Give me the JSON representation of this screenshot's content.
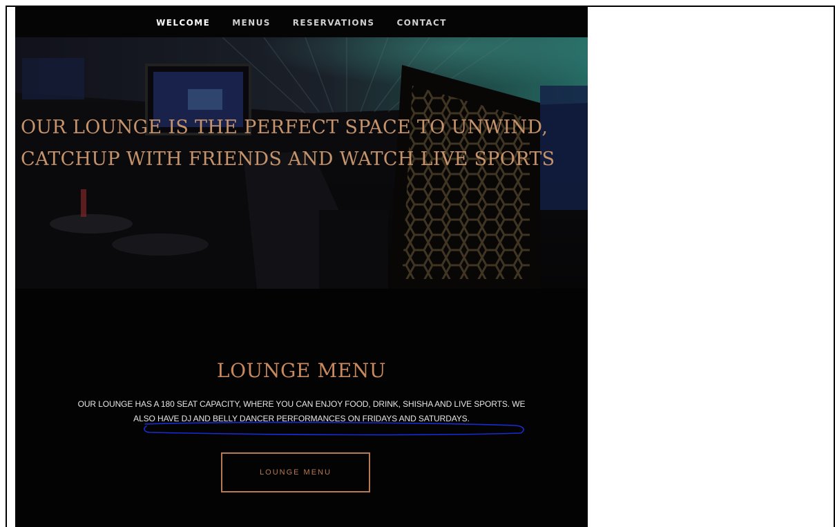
{
  "nav": {
    "items": [
      {
        "label": "WELCOME",
        "active": true
      },
      {
        "label": "MENUS",
        "active": false
      },
      {
        "label": "RESERVATIONS",
        "active": false
      },
      {
        "label": "CONTACT",
        "active": false
      }
    ]
  },
  "hero": {
    "headline": "OUR LOUNGE IS THE PERFECT SPACE TO UNWIND,\nCATCHUP WITH FRIENDS AND WATCH LIVE SPORTS"
  },
  "lounge": {
    "title": "LOUNGE MENU",
    "description_line1": "OUR LOUNGE HAS A 180 SEAT CAPACITY, WHERE YOU CAN ENJOY FOOD, DRINK, SHISHA AND LIVE SPORTS. WE",
    "description_line2": "ALSO HAVE DJ AND BELLY DANCER PERFORMANCES ON FRIDAYS AND SATURDAYS.",
    "button_label": "LOUNGE MENU"
  },
  "colors": {
    "accent": "#c8895f",
    "background": "#030303",
    "nav_text": "#ffffff",
    "annotation": "#1a2bd6"
  }
}
